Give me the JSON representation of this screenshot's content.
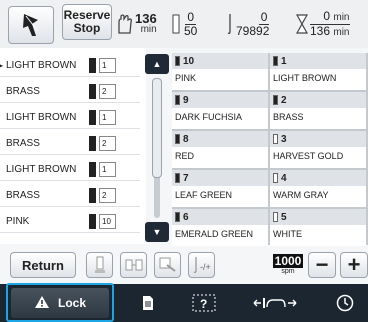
{
  "topbar": {
    "reserve_stop_line1": "Reserve",
    "reserve_stop_line2": "Stop",
    "time_value": "136",
    "time_unit": "min",
    "stitch_current": "0",
    "stitch_total_color": "50",
    "stitch_count_current": "0",
    "stitch_count_total": "79892",
    "time_elapsed": "0",
    "time_elapsed_unit": "min",
    "time_total": "136",
    "time_total_unit": "min"
  },
  "left_list": [
    {
      "name": "LIGHT BROWN",
      "count": "1"
    },
    {
      "name": "BRASS",
      "count": "2"
    },
    {
      "name": "LIGHT BROWN",
      "count": "1"
    },
    {
      "name": "BRASS",
      "count": "2"
    },
    {
      "name": "LIGHT BROWN",
      "count": "1"
    },
    {
      "name": "BRASS",
      "count": "2"
    },
    {
      "name": "PINK",
      "count": "10"
    }
  ],
  "grid": [
    {
      "num": "10",
      "name": "PINK",
      "spool_color": "#222222"
    },
    {
      "num": "1",
      "name": "LIGHT BROWN",
      "spool_color": "#222222"
    },
    {
      "num": "9",
      "name": "DARK FUCHSIA",
      "spool_color": "#222222"
    },
    {
      "num": "2",
      "name": "BRASS",
      "spool_color": "#222222"
    },
    {
      "num": "8",
      "name": "RED",
      "spool_color": "#222222"
    },
    {
      "num": "3",
      "name": "HARVEST GOLD",
      "spool_color": "#ffffff"
    },
    {
      "num": "7",
      "name": "LEAF GREEN",
      "spool_color": "#222222"
    },
    {
      "num": "4",
      "name": "WARM GRAY",
      "spool_color": "#ffffff"
    },
    {
      "num": "6",
      "name": "EMERALD GREEN",
      "spool_color": "#222222"
    },
    {
      "num": "5",
      "name": "WHITE",
      "spool_color": "#ffffff"
    }
  ],
  "tools": {
    "return_label": "Return",
    "speed_value": "1000",
    "speed_unit": "spm",
    "minus_label": "−",
    "plus_label": "+"
  },
  "bottom": {
    "lock_label": "Lock"
  },
  "colors": {
    "accent_blue": "#1da6e6",
    "bottom_bar": "#1c2630"
  }
}
